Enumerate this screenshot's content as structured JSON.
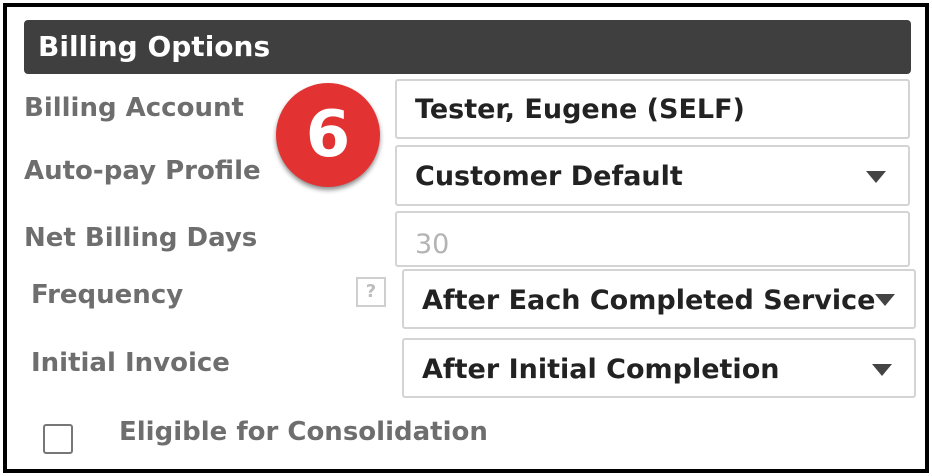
{
  "section": {
    "title": "Billing Options"
  },
  "annotation": {
    "step_number": "6",
    "color": "#e23232"
  },
  "fields": {
    "billing_account": {
      "label": "Billing Account",
      "value": "Tester, Eugene (SELF)"
    },
    "autopay_profile": {
      "label": "Auto-pay Profile",
      "value": "Customer Default"
    },
    "net_billing_days": {
      "label": "Net Billing Days",
      "value": "30"
    },
    "frequency": {
      "label": "Frequency",
      "help_glyph": "?",
      "value": "After Each Completed Service"
    },
    "initial_invoice": {
      "label": "Initial Invoice",
      "value": "After Initial Completion"
    }
  },
  "consolidation": {
    "label": "Eligible for Consolidation",
    "checked": false
  },
  "icons": {
    "dropdown": "caret-down-icon",
    "help": "help-icon"
  }
}
